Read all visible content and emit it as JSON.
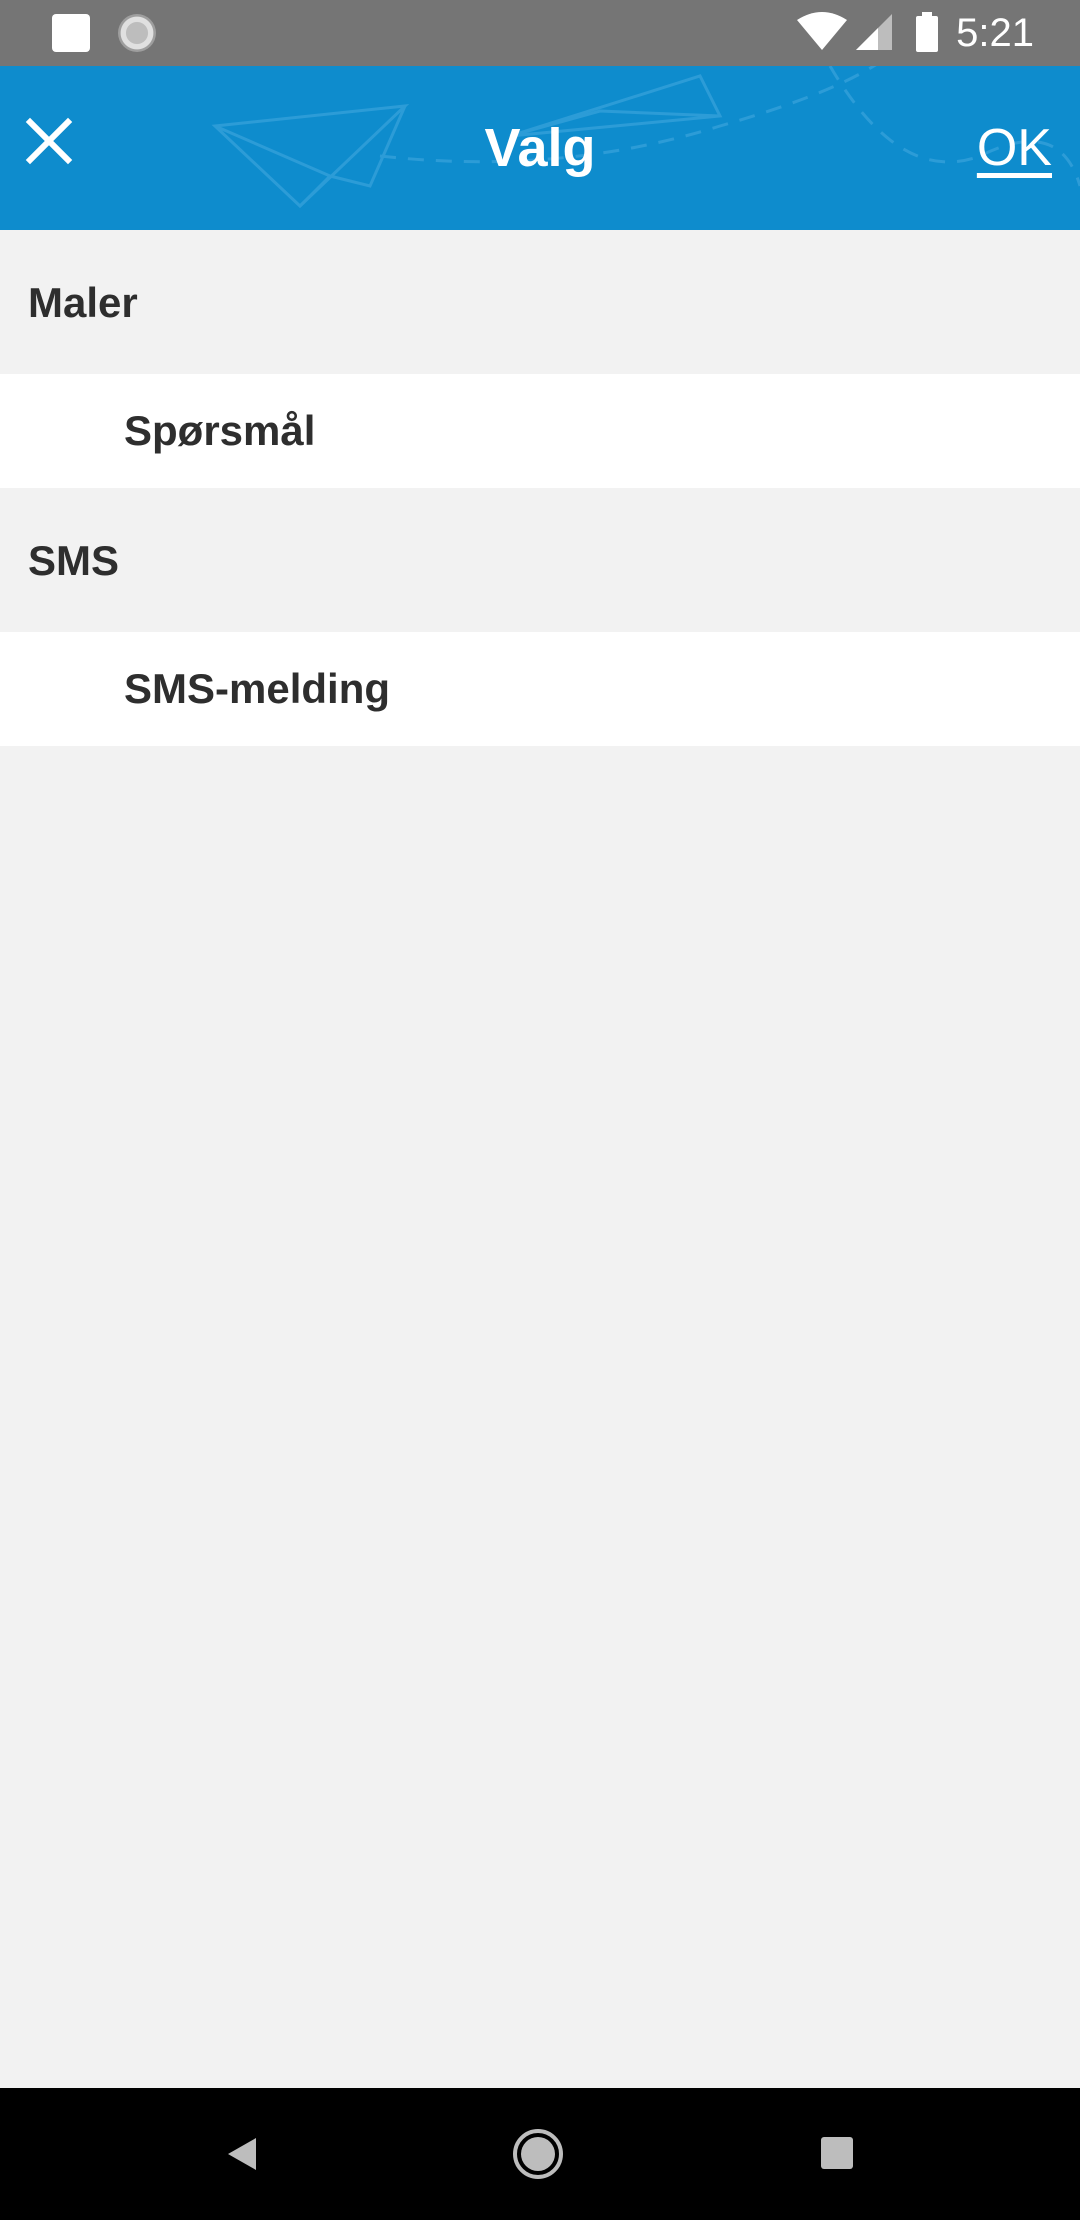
{
  "status_bar": {
    "time": "5:21",
    "icons": [
      "notification-square-icon",
      "notification-circle-icon",
      "wifi-icon",
      "signal-icon",
      "battery-icon"
    ]
  },
  "toolbar": {
    "title": "Valg",
    "ok_label": "OK",
    "close_icon": "close-icon",
    "background_color": "#0e8ccd"
  },
  "sections": [
    {
      "header": "Maler",
      "items": [
        {
          "label": "Spørsmål"
        }
      ]
    },
    {
      "header": "SMS",
      "items": [
        {
          "label": "SMS-melding"
        }
      ]
    }
  ],
  "nav_bar": {
    "icons": [
      "back-icon",
      "home-icon",
      "recents-icon"
    ]
  }
}
